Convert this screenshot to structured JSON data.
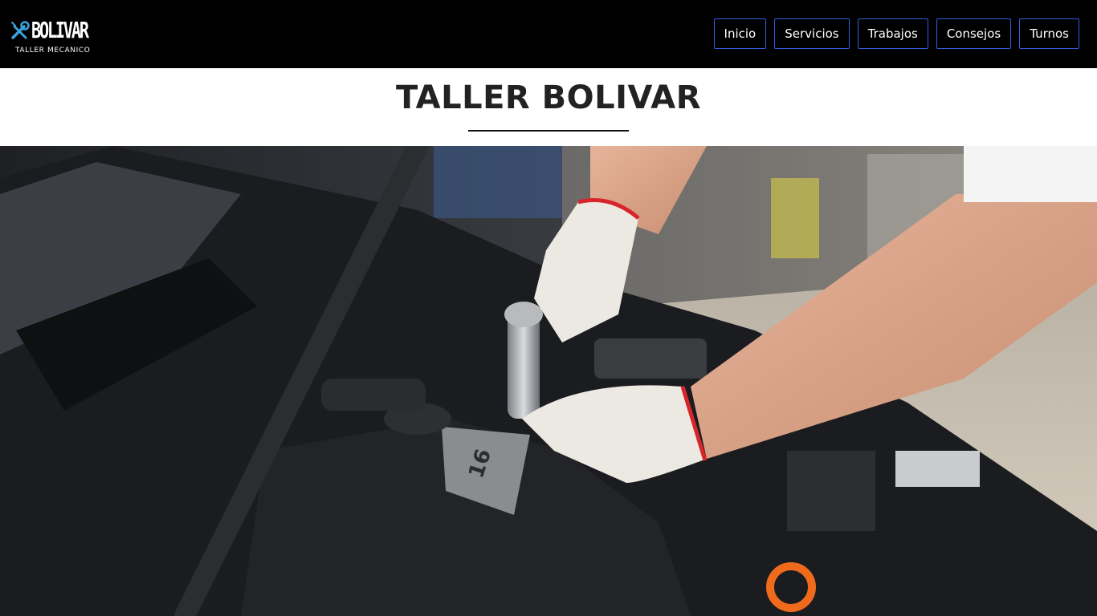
{
  "header": {
    "logo": {
      "name": "BOLIVAR",
      "subtitle": "TALLER MECANICO",
      "icon": "wrench-screwdriver-icon"
    },
    "nav": [
      {
        "label": "Inicio"
      },
      {
        "label": "Servicios"
      },
      {
        "label": "Trabajos"
      },
      {
        "label": "Consejos"
      },
      {
        "label": "Turnos"
      }
    ]
  },
  "main": {
    "title": "TALLER BOLIVAR",
    "hero_image": "mechanic-working-on-engine-photo"
  },
  "colors": {
    "navbar_bg": "#000000",
    "nav_border": "#2f5fe0",
    "accent_icon": "#3aa3e0",
    "title_text": "#222222"
  }
}
